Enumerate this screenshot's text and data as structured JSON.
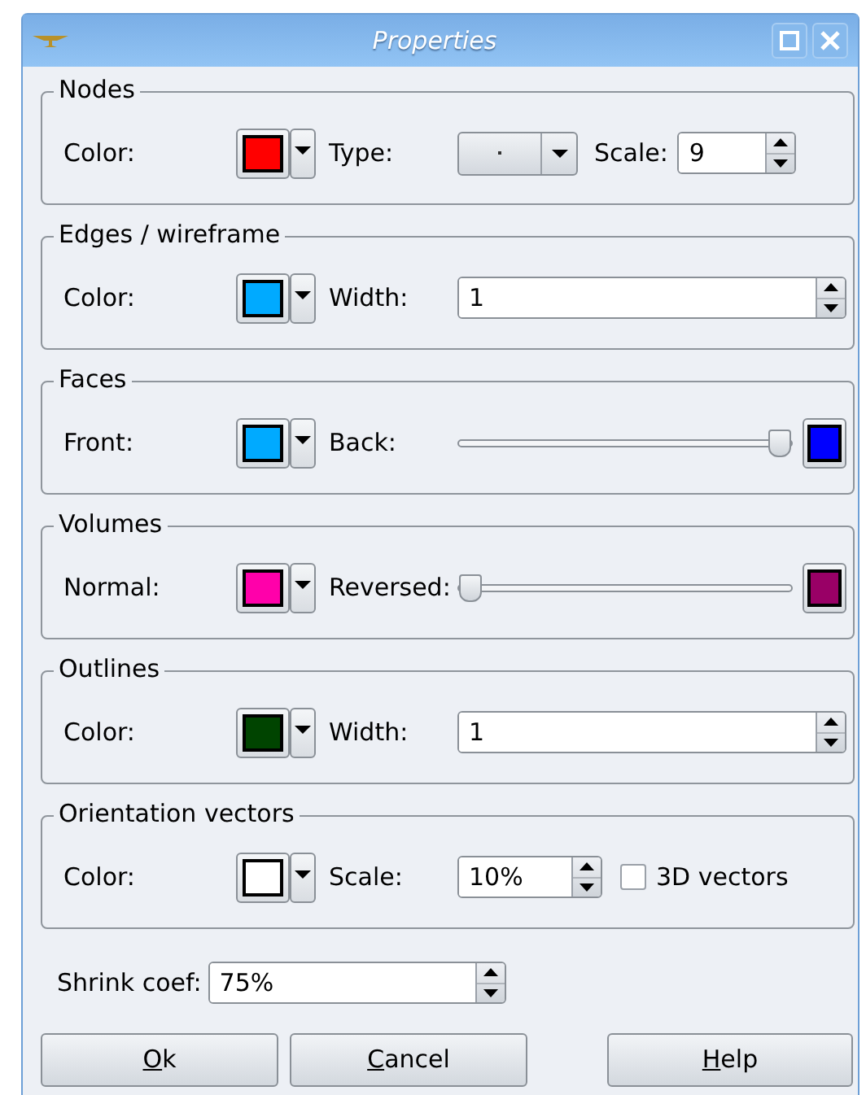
{
  "window": {
    "title": "Properties"
  },
  "groups": [
    {
      "title": "Nodes",
      "fields": [
        {
          "kind": "color",
          "label": "Color:",
          "color": "#ff0000"
        },
        {
          "kind": "combo",
          "label": "Type:"
        },
        {
          "kind": "spin",
          "label": "Scale:",
          "value": "9"
        }
      ]
    },
    {
      "title": "Edges / wireframe",
      "fields": [
        {
          "kind": "color",
          "label": "Color:",
          "color": "#00aaff"
        },
        {
          "kind": "wide_spin",
          "label": "Width:",
          "value": "1"
        }
      ]
    },
    {
      "title": "Faces",
      "fields": [
        {
          "kind": "color",
          "label": "Front:",
          "color": "#00aaff"
        },
        {
          "kind": "slider",
          "label": "Back:",
          "level": 1,
          "color": "#0000ff"
        }
      ]
    },
    {
      "title": "Volumes",
      "fields": [
        {
          "kind": "color",
          "label": "Normal:",
          "color": "#ff00aa"
        },
        {
          "kind": "slider",
          "label": "Reversed:",
          "level": 0,
          "color": "#990066"
        }
      ]
    },
    {
      "title": "Outlines",
      "fields": [
        {
          "kind": "color",
          "label": "Color:",
          "color": "#004400"
        },
        {
          "kind": "wide_spin",
          "label": "Width:",
          "value": "1"
        }
      ]
    },
    {
      "title": "Orientation vectors",
      "fields": [
        {
          "kind": "color",
          "label": "Color:",
          "color": "#ffffff"
        },
        {
          "kind": "short_spin",
          "label": "Scale:",
          "value": "10%"
        },
        {
          "kind": "checkbox",
          "label": "3D vectors",
          "checked": false
        }
      ]
    }
  ],
  "shrink": {
    "label": "Shrink coef:",
    "value": "75%"
  },
  "buttons": [
    {
      "access_key": "O",
      "rest": "k"
    },
    {
      "access_key": "C",
      "rest": "ancel"
    },
    {
      "access_key": "H",
      "rest": "elp"
    }
  ]
}
